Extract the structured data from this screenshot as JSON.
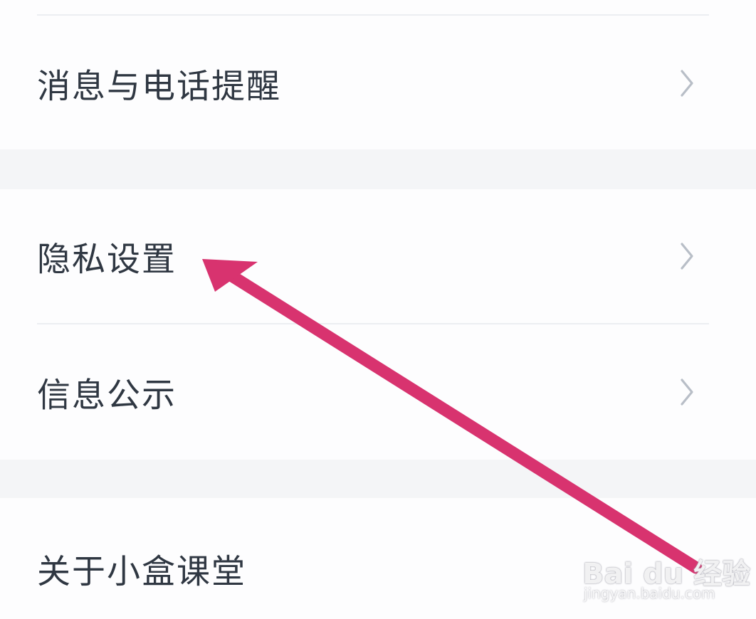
{
  "settings": {
    "items": [
      {
        "label": "消息与电话提醒",
        "icon": "chevron-right-icon"
      },
      {
        "label": "隐私设置",
        "icon": "chevron-right-icon"
      },
      {
        "label": "信息公示",
        "icon": "chevron-right-icon"
      },
      {
        "label": "关于小盒课堂",
        "icon": "chevron-right-icon"
      }
    ]
  },
  "annotation": {
    "arrow_color": "#d8336f",
    "target": "隐私设置"
  },
  "watermark": {
    "logo_text": "Bai du 经验",
    "url_text": "jingyan.baidu.com"
  },
  "colors": {
    "background": "#fdfdfe",
    "section_gap": "#f4f5f7",
    "divider": "#eceef2",
    "label_text": "#2f3742",
    "chevron": "#b8bec7"
  }
}
